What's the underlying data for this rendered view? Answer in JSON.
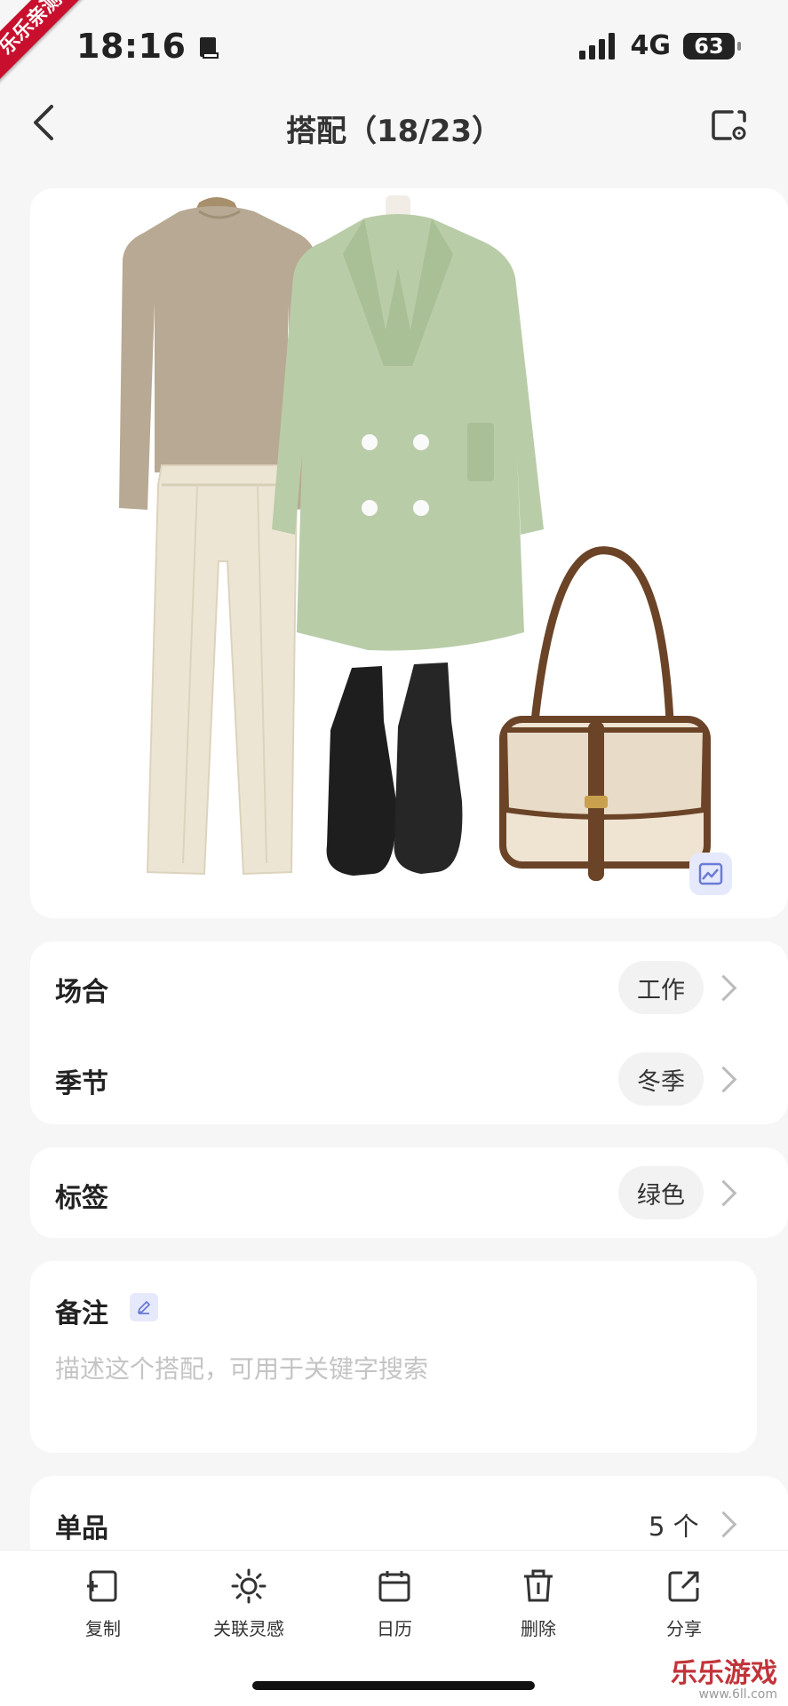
{
  "status": {
    "time": "18:16",
    "network": "4G",
    "battery": "63"
  },
  "ribbon": "乐乐亲测",
  "nav": {
    "title": "搭配（18/23）"
  },
  "outfit": {
    "items": [
      "sweater",
      "coat",
      "trousers",
      "boots",
      "handbag"
    ]
  },
  "attributes": [
    {
      "label": "场合",
      "value": "工作"
    },
    {
      "label": "季节",
      "value": "冬季"
    }
  ],
  "tags": {
    "label": "标签",
    "value": "绿色"
  },
  "notes": {
    "label": "备注",
    "placeholder": "描述这个搭配，可用于关键字搜索"
  },
  "items_row": {
    "label": "单品",
    "count": "5 个"
  },
  "toolbar": [
    {
      "label": "复制",
      "icon": "copy-icon"
    },
    {
      "label": "关联灵感",
      "icon": "sun-icon"
    },
    {
      "label": "日历",
      "icon": "calendar-icon"
    },
    {
      "label": "删除",
      "icon": "trash-icon"
    },
    {
      "label": "分享",
      "icon": "share-icon"
    }
  ],
  "watermark": {
    "name": "乐乐游戏",
    "url": "www.6ll.com"
  },
  "colors": {
    "accent": "#6b7bd6",
    "coat": "#b9cca8",
    "sweater": "#b8a994",
    "trousers": "#ece5d3",
    "boots": "#1e1e1e",
    "bag_body": "#efe3d2",
    "bag_trim": "#6b4428",
    "watermark": "#c2343a"
  }
}
